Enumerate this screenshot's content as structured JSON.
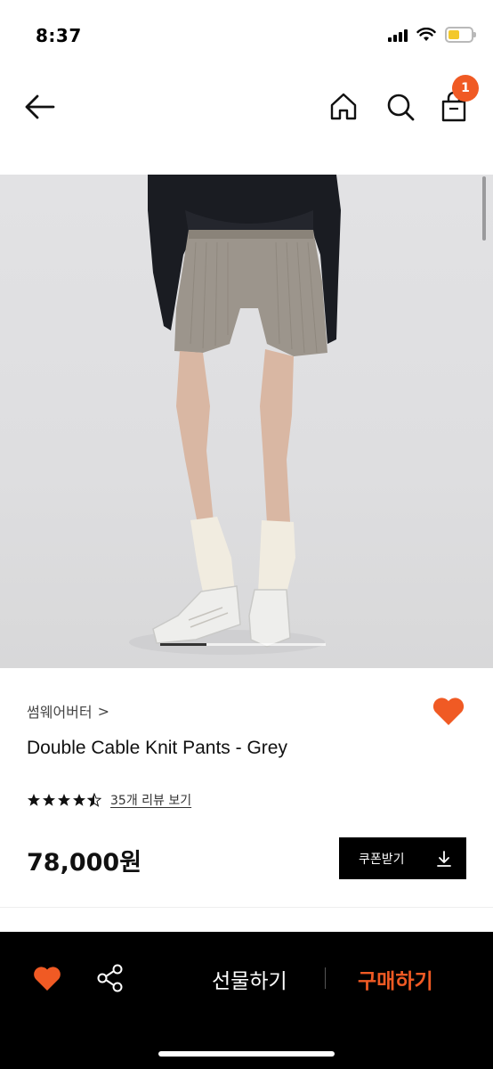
{
  "status_bar": {
    "time": "8:37"
  },
  "nav": {
    "back_icon": "arrow-left-icon",
    "home_icon": "home-icon",
    "search_icon": "search-icon",
    "cart_icon": "shopping-bag-icon",
    "cart_badge": "1"
  },
  "product": {
    "brand": "썸웨어버터",
    "brand_chevron": ">",
    "name": "Double Cable Knit Pants - Grey",
    "rating": 4.5,
    "rating_max": 5,
    "review_link": "35개 리뷰 보기",
    "price": "78,000원",
    "coupon_button": "쿠폰받기",
    "image_index": 1,
    "image_count_fraction_shown": 0.28
  },
  "bottom_bar": {
    "gift_button": "선물하기",
    "buy_button": "구매하기"
  },
  "colors": {
    "accent": "#f05a24",
    "coupon_bg": "#000000",
    "bottom_bar_bg": "#000000"
  }
}
